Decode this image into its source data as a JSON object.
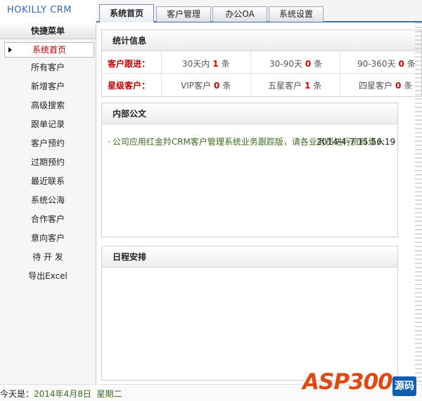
{
  "app": {
    "logo": "HOKILLY CRM"
  },
  "tabs": [
    {
      "label": "系统首页",
      "active": true
    },
    {
      "label": "客户管理",
      "active": false
    },
    {
      "label": "办公OA",
      "active": false
    },
    {
      "label": "系统设置",
      "active": false
    }
  ],
  "sidebar": {
    "title": "快捷菜单",
    "items": [
      {
        "label": "系统首页",
        "active": true
      },
      {
        "label": "所有客户"
      },
      {
        "label": "新增客户"
      },
      {
        "label": "高级搜索"
      },
      {
        "label": "跟单记录"
      },
      {
        "label": "客户预约"
      },
      {
        "label": "过期预约"
      },
      {
        "label": "最近联系"
      },
      {
        "label": "系统公海"
      },
      {
        "label": "合作客户"
      },
      {
        "label": "意向客户"
      },
      {
        "label": "待 开 发"
      },
      {
        "label": "导出Excel"
      }
    ]
  },
  "stats": {
    "title": "统计信息",
    "rows": [
      {
        "label": "客户跟进：",
        "cells": [
          {
            "prefix": "30天内",
            "count": "1",
            "unit": "条"
          },
          {
            "prefix": "30-90天",
            "count": "0",
            "unit": "条"
          },
          {
            "prefix": "90-360天",
            "count": "0",
            "unit": "条"
          }
        ]
      },
      {
        "label": "星级客户：",
        "cells": [
          {
            "prefix": "VIP客户",
            "count": "0",
            "unit": "条"
          },
          {
            "prefix": "五星客户",
            "count": "1",
            "unit": "条"
          },
          {
            "prefix": "四星客户",
            "count": "0",
            "unit": "条"
          }
        ]
      }
    ]
  },
  "notice": {
    "title": "内部公文",
    "items": [
      {
        "bullet": "·",
        "text": "公司应用红金羚CRM客户管理系统业务跟踪版，请各业务员进行资料录入",
        "date": "2014-4-7 15:56:19"
      }
    ]
  },
  "schedule": {
    "title": "日程安排"
  },
  "status": {
    "prefix": "今天是：",
    "date": "2014年4月8日",
    "weekday": "星期二"
  },
  "watermark": {
    "brand": "ASP300",
    "suffix": "源码"
  },
  "colors": {
    "accent": "#3a6ea5",
    "alert": "#c00000",
    "link_green": "#3b6a23"
  }
}
